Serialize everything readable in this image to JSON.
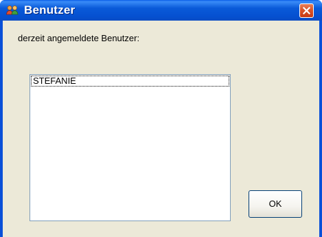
{
  "window": {
    "title": "Benutzer",
    "title_icon": "users-icon",
    "close_icon": "close-icon"
  },
  "dialog": {
    "prompt": "derzeit angemeldete Benutzer:",
    "users": [
      "STEFANIE"
    ],
    "ok_label": "OK"
  },
  "colors": {
    "titlebar": "#0a5ad8",
    "close_button": "#d9542a",
    "client_background": "#ece9d8",
    "list_border": "#7f9db9"
  }
}
